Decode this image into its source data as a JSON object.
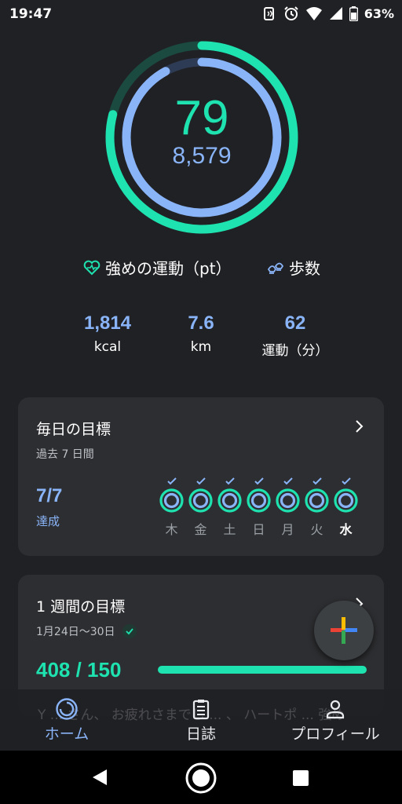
{
  "status_bar": {
    "time": "19:47",
    "battery_percent": "63%",
    "icons": [
      "nfc-icon",
      "alarm-icon",
      "wifi-icon",
      "signal-icon",
      "battery-icon"
    ]
  },
  "ring": {
    "heart_points": "79",
    "steps": "8,579",
    "heart_points_progress": 0.79,
    "steps_progress": 0.92,
    "colors": {
      "heart": "#1ee3b0",
      "steps": "#8ab4f8"
    }
  },
  "legend": {
    "heart_label": "強めの運動（pt）",
    "steps_label": "歩数"
  },
  "stats": [
    {
      "value": "1,814",
      "label": "kcal"
    },
    {
      "value": "7.6",
      "label": "km"
    },
    {
      "value": "62",
      "label": "運動（分）"
    }
  ],
  "daily_goal": {
    "title": "毎日の目標",
    "subtitle": "過去 7 日間",
    "achieved": "7/7",
    "achieved_label": "達成",
    "days": [
      {
        "label": "木",
        "achieved": true,
        "today": false
      },
      {
        "label": "金",
        "achieved": true,
        "today": false
      },
      {
        "label": "土",
        "achieved": true,
        "today": false
      },
      {
        "label": "日",
        "achieved": true,
        "today": false
      },
      {
        "label": "月",
        "achieved": true,
        "today": false
      },
      {
        "label": "火",
        "achieved": true,
        "today": false
      },
      {
        "label": "水",
        "achieved": true,
        "today": true
      }
    ]
  },
  "weekly_goal": {
    "title": "1 週間の目標",
    "date_range": "1月24日〜30日",
    "progress_text": "408 / 150",
    "progress": 1.0
  },
  "bottom_nav": {
    "background_text": "Y ... さん、 お疲れさまでし ... 、 ハートポ ... 強め",
    "items": [
      {
        "label": "ホーム",
        "icon": "home-ring-icon",
        "active": true
      },
      {
        "label": "日誌",
        "icon": "journal-icon",
        "active": false
      },
      {
        "label": "プロフィール",
        "icon": "profile-icon",
        "active": false
      }
    ],
    "active_color": "#8ab4f8"
  },
  "system_nav": {
    "icons": [
      "back-icon",
      "home-icon",
      "recents-icon"
    ]
  }
}
